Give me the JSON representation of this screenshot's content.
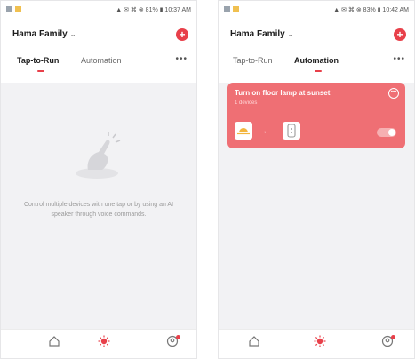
{
  "colors": {
    "accent": "#e8404a",
    "card": "#ef6f74",
    "background": "#f2f2f4"
  },
  "left_screen": {
    "status_text": "▲ ✉ ⌘ ⊗ 81% ▮ 10:37 AM",
    "home_title": "Hama Family",
    "tabs": [
      "Tap-to-Run",
      "Automation"
    ],
    "active_tab": "Tap-to-Run",
    "empty_message": "Control multiple devices with one tap or by using an AI speaker through voice commands."
  },
  "right_screen": {
    "status_text": "▲ ✉ ⌘ ⊗ 83% ▮ 10:42 AM",
    "home_title": "Hama Family",
    "tabs": [
      "Tap-to-Run",
      "Automation"
    ],
    "active_tab": "Automation",
    "scene": {
      "title": "Turn on floor lamp at sunset",
      "subtitle": "1 devices",
      "enabled": true
    }
  },
  "icons": {
    "add": "plus-icon",
    "more": "more-dots-icon",
    "home": "home-icon",
    "smart": "sun-icon",
    "profile": "profile-icon"
  }
}
